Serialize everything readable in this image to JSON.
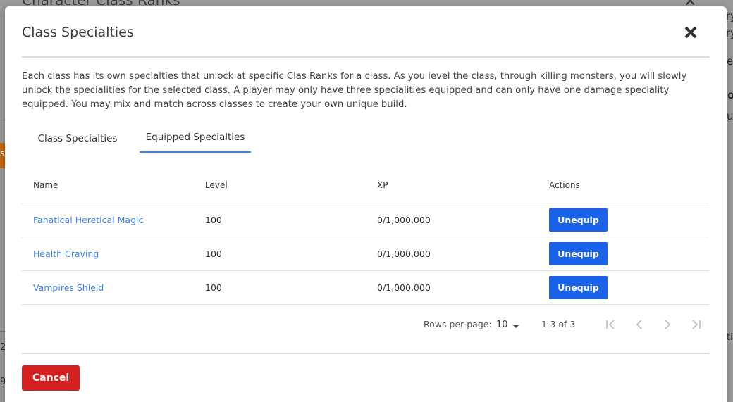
{
  "background": {
    "title": "Character Class Ranks",
    "close_glyph": "✕",
    "fragments": [
      "ry",
      "ry",
      "e",
      "o",
      "ur",
      "s",
      "2",
      "9",
      "ti"
    ]
  },
  "modal": {
    "title": "Class Specialties",
    "close_icon": "close-icon",
    "description": "Each class has its own specialties that unlock at specific Clas Ranks for a class. As you level the class, through killing monsters, you will slowly unlock the specialities for the selected class. A player may only have three specialities equipped and can only have one damage speciality equipped. You may mix and match across classes to create your own unique build.",
    "tabs": [
      {
        "label": "Class Specialties",
        "active": false
      },
      {
        "label": "Equipped Specialties",
        "active": true
      }
    ],
    "table": {
      "headers": [
        "Name",
        "Level",
        "XP",
        "Actions"
      ],
      "rows": [
        {
          "name": "Fanatical Heretical Magic",
          "level": "100",
          "xp": "0/1,000,000",
          "action": "Unequip"
        },
        {
          "name": "Health Craving",
          "level": "100",
          "xp": "0/1,000,000",
          "action": "Unequip"
        },
        {
          "name": "Vampires Shield",
          "level": "100",
          "xp": "0/1,000,000",
          "action": "Unequip"
        }
      ]
    },
    "pagination": {
      "rows_per_page_label": "Rows per page:",
      "rows_per_page_value": "10",
      "range": "1-3 of 3",
      "icons": [
        "first-page-icon",
        "previous-page-icon",
        "next-page-icon",
        "last-page-icon"
      ]
    },
    "cancel_label": "Cancel"
  },
  "colors": {
    "accent": "#3b82f6",
    "primary_button": "#1a62e8",
    "danger_button": "#d62020",
    "overlay": "#9a9a9a"
  }
}
